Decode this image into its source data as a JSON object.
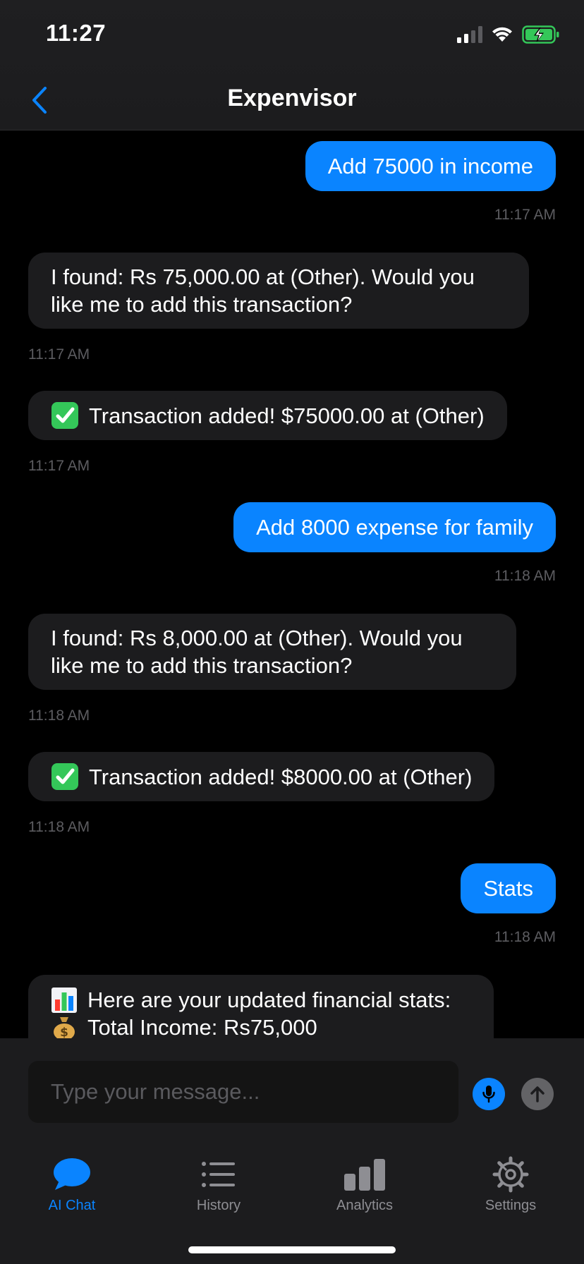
{
  "status_bar": {
    "time": "11:27"
  },
  "header": {
    "title": "Expenvisor"
  },
  "messages": [
    {
      "text": "Add 75000 in income",
      "time": "11:17 AM"
    },
    {
      "text": "I found: Rs 75,000.00 at  (Other). Would you like me to add this transaction?",
      "line1": "I found: Rs 75,000.00 at  (Other). Would you",
      "line2": "like me to add this transaction?",
      "time": "11:17 AM"
    },
    {
      "emoji": "check-mark-icon",
      "text": "Transaction added! $75000.00 at  (Other)",
      "time": "11:17 AM"
    },
    {
      "text": "Add 8000 expense for family",
      "time": "11:18 AM"
    },
    {
      "text": "I found: Rs 8,000.00 at  (Other). Would you like me to add this transaction?",
      "line1": "I found: Rs 8,000.00 at  (Other). Would you",
      "line2": "like me to add this transaction?",
      "time": "11:18 AM"
    },
    {
      "emoji": "check-mark-icon",
      "text": "Transaction added! $8000.00 at  (Other)",
      "time": "11:18 AM"
    },
    {
      "text": "Stats",
      "time": "11:18 AM"
    },
    {
      "line1_emoji": "bar-chart-icon",
      "line1": "Here are your updated financial stats:",
      "line2_emoji": "money-bag-icon",
      "line2": "Total Income: Rs75,000"
    }
  ],
  "input": {
    "placeholder": "Type your message..."
  },
  "tabs": [
    {
      "label": "AI Chat",
      "icon": "chat-bubble-icon",
      "active": true
    },
    {
      "label": "History",
      "icon": "list-icon",
      "active": false
    },
    {
      "label": "Analytics",
      "icon": "bar-chart-icon",
      "active": false
    },
    {
      "label": "Settings",
      "icon": "gear-icon",
      "active": false
    }
  ],
  "colors": {
    "accent": "#0a84ff",
    "bubble_bot": "#1c1c1e",
    "background": "#000000",
    "battery": "#34c759",
    "timestamp": "#5c5c60"
  }
}
